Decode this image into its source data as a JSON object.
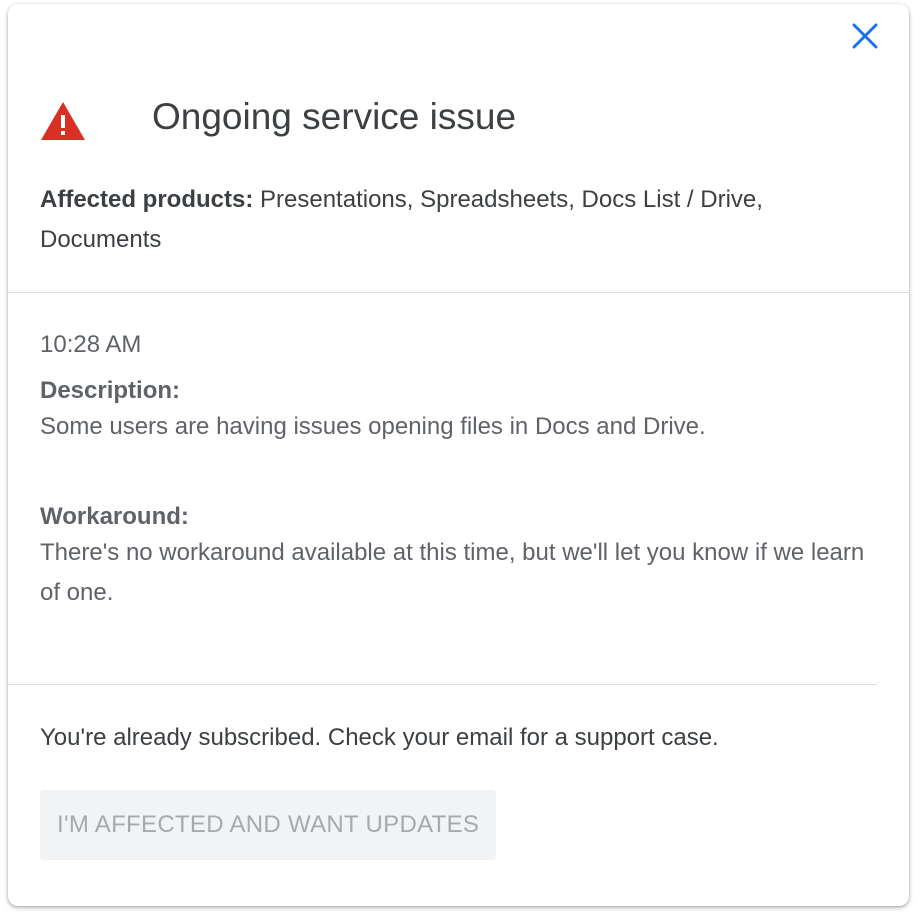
{
  "dialog": {
    "title": "Ongoing service issue",
    "close_icon": "close-icon",
    "warning_icon": "warning-triangle-icon",
    "accent_color": "#1a73e8",
    "warning_color": "#d93025"
  },
  "affected": {
    "label": "Affected products:",
    "products": "Presentations, Spreadsheets, Docs List / Drive, Documents"
  },
  "update": {
    "time": "10:28 AM",
    "description_label": "Description:",
    "description_text": "Some users are having issues opening files in Docs and Drive.",
    "workaround_label": "Workaround:",
    "workaround_text": "There's no workaround available at this time, but we'll let you know if we learn of one."
  },
  "footer": {
    "subscribed_text": "You're already subscribed. Check your email for a support case.",
    "button_label": "I'M AFFECTED AND WANT UPDATES",
    "button_disabled": true
  }
}
